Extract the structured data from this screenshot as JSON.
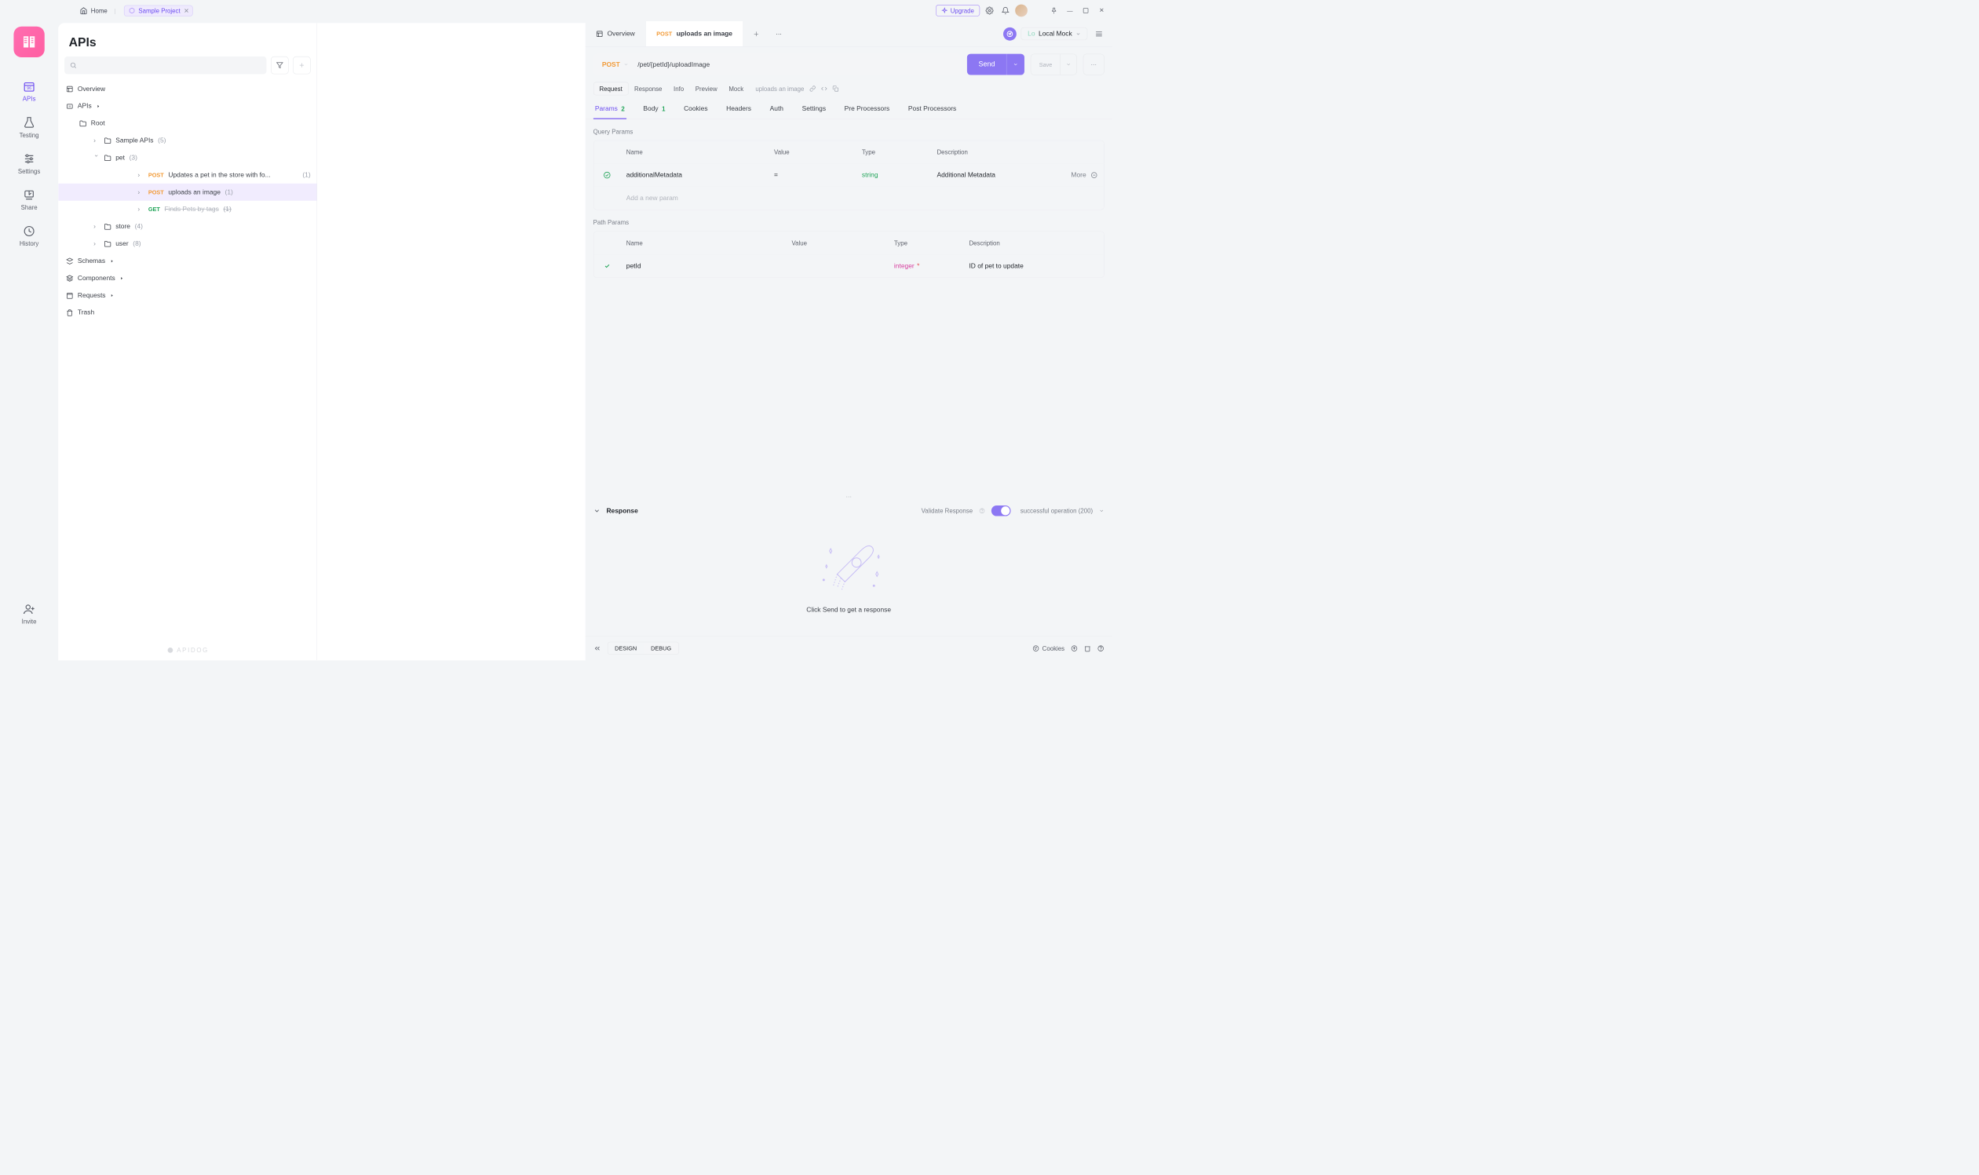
{
  "titlebar": {
    "home": "Home",
    "project_tab": "Sample Project",
    "upgrade": "Upgrade"
  },
  "rail": {
    "apis": "APIs",
    "testing": "Testing",
    "settings": "Settings",
    "share": "Share",
    "history": "History",
    "invite": "Invite"
  },
  "sidebar": {
    "title": "APIs",
    "overview": "Overview",
    "apis_label": "APIs",
    "root": "Root",
    "sample_apis": "Sample APIs",
    "sample_apis_cnt": "(5)",
    "pet": "pet",
    "pet_cnt": "(3)",
    "pet_items": [
      {
        "method": "POST",
        "name": "Updates a pet in the store with fo...",
        "cnt": "(1)"
      },
      {
        "method": "POST",
        "name": "uploads an image",
        "cnt": "(1)"
      },
      {
        "method": "GET",
        "name": "Finds Pets by tags",
        "cnt": "(1)",
        "deprecated": true
      }
    ],
    "store": "store",
    "store_cnt": "(4)",
    "user": "user",
    "user_cnt": "(8)",
    "schemas": "Schemas",
    "components": "Components",
    "requests": "Requests",
    "trash": "Trash",
    "watermark": "APIDOG"
  },
  "tabs": {
    "overview": "Overview",
    "active_method": "POST",
    "active_name": "uploads an image"
  },
  "env": {
    "prefix": "Lo",
    "name": "Local Mock"
  },
  "request": {
    "method": "POST",
    "url": "/pet/{petId}/uploadImage",
    "send": "Send",
    "save": "Save"
  },
  "pills": {
    "request": "Request",
    "response": "Response",
    "info": "Info",
    "preview": "Preview",
    "mock": "Mock",
    "name": "uploads an image"
  },
  "itabs": {
    "params": "Params",
    "params_n": "2",
    "body": "Body",
    "body_n": "1",
    "cookies": "Cookies",
    "headers": "Headers",
    "auth": "Auth",
    "settings": "Settings",
    "pre": "Pre Processors",
    "post": "Post Processors"
  },
  "qp": {
    "title": "Query Params",
    "hdr": {
      "name": "Name",
      "value": "Value",
      "type": "Type",
      "desc": "Description"
    },
    "rows": [
      {
        "name": "additionalMetadata",
        "value": "=",
        "type": "string",
        "desc": "Additional Metadata"
      }
    ],
    "add": "Add a new param",
    "more": "More"
  },
  "pp": {
    "title": "Path Params",
    "hdr": {
      "name": "Name",
      "value": "Value",
      "type": "Type",
      "desc": "Description"
    },
    "rows": [
      {
        "name": "petId",
        "value": "",
        "type": "integer",
        "required": true,
        "desc": "ID of pet to update"
      }
    ]
  },
  "response": {
    "title": "Response",
    "validate": "Validate Response",
    "status": "successful operation (200)",
    "empty": "Click Send to get a response"
  },
  "footer": {
    "design": "DESIGN",
    "debug": "DEBUG",
    "cookies": "Cookies"
  }
}
